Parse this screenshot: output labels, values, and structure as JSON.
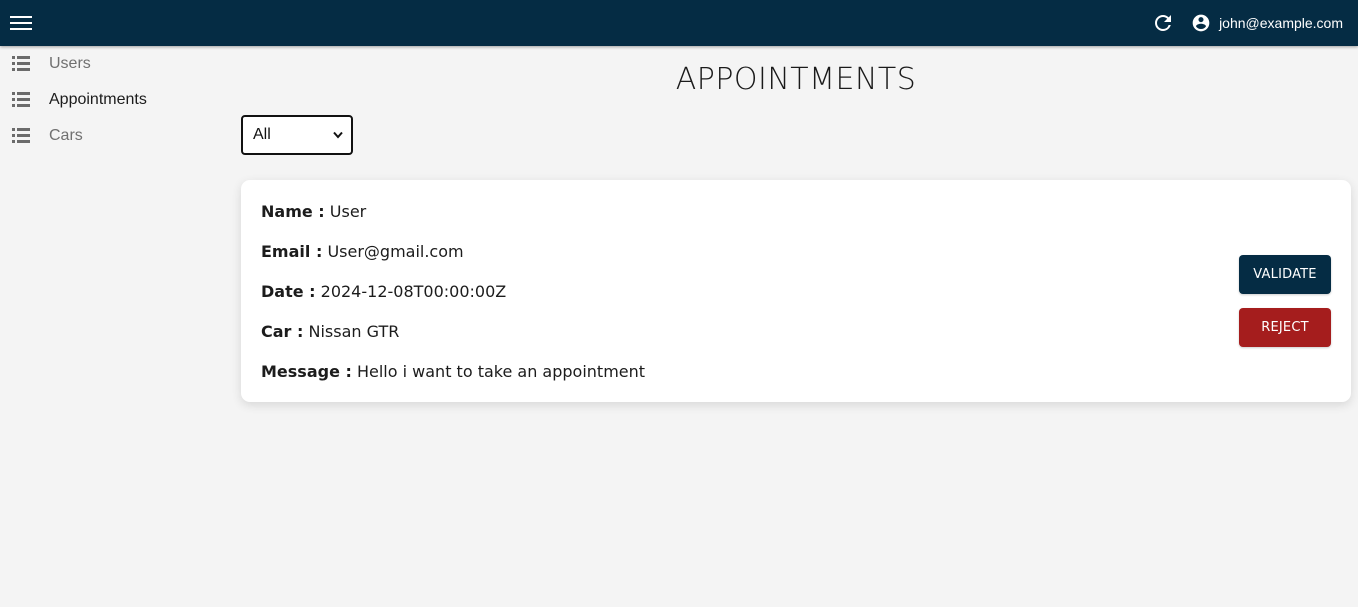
{
  "header": {
    "user_email": "john@example.com",
    "background_color": "#052c44"
  },
  "sidebar": {
    "items": [
      {
        "label": "Users",
        "icon": "list-icon",
        "active": false
      },
      {
        "label": "Appointments",
        "icon": "list-icon",
        "active": true
      },
      {
        "label": "Cars",
        "icon": "list-icon",
        "active": false
      }
    ]
  },
  "main": {
    "title": "APPOINTMENTS",
    "filter": {
      "selected": "All"
    },
    "appointment": {
      "name_label": "Name :",
      "name": "User",
      "email_label": "Email :",
      "email": "User@gmail.com",
      "date_label": "Date :",
      "date": "2024-12-08T00:00:00Z",
      "car_label": "Car :",
      "car": "Nissan GTR",
      "message_label": "Message :",
      "message": "Hello i want to take an appointment"
    },
    "actions": {
      "validate_label": "VALIDATE",
      "reject_label": "REJECT",
      "validate_color": "#052c44",
      "reject_color": "#a51d1d"
    }
  }
}
